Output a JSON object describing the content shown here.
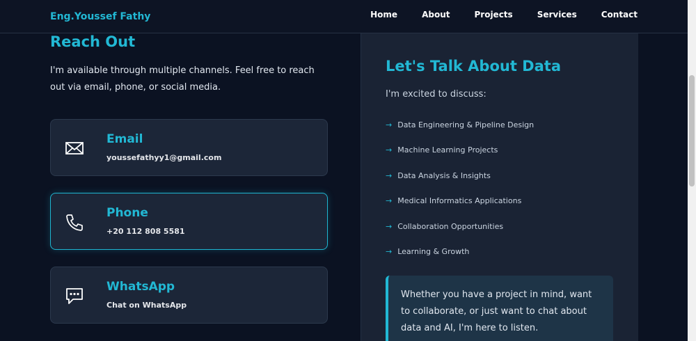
{
  "nav": {
    "brand": "Eng.Youssef Fathy",
    "links": [
      "Home",
      "About",
      "Projects",
      "Services",
      "Contact"
    ]
  },
  "reach": {
    "title": "Reach Out",
    "intro": "I'm available through multiple channels. Feel free to reach out via email, phone, or social media."
  },
  "contacts": [
    {
      "title": "Email",
      "value": "youssefathyy1@gmail.com",
      "icon": "envelope-icon"
    },
    {
      "title": "Phone",
      "value": "+20 112 808 5581",
      "icon": "phone-icon"
    },
    {
      "title": "WhatsApp",
      "value": "Chat on WhatsApp",
      "icon": "chat-icon"
    }
  ],
  "talk": {
    "title": "Let's Talk About Data",
    "intro": "I'm excited to discuss:",
    "arrow": "→",
    "topics": [
      "Data Engineering & Pipeline Design",
      "Machine Learning Projects",
      "Data Analysis & Insights",
      "Medical Informatics Applications",
      "Collaboration Opportunities",
      "Learning & Growth"
    ],
    "quote": "Whether you have a project in mind, want to collaborate, or just want to chat about data and AI, I'm here to listen."
  },
  "colors": {
    "accent": "#22b8d4",
    "background": "#0b1222",
    "card": "#1c2638"
  }
}
